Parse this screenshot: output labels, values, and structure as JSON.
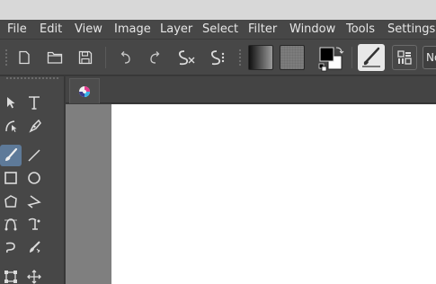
{
  "menubar": {
    "items": [
      "File",
      "Edit",
      "View",
      "Image",
      "Layer",
      "Select",
      "Filter",
      "Window",
      "Tools",
      "Settings"
    ]
  },
  "toolbar": {
    "buttons": [
      "new-document",
      "open-document",
      "save",
      "undo",
      "redo",
      "clear-selection",
      "select-all",
      "gradient",
      "pattern",
      "foreground-background-colors",
      "brush-preset",
      "workspace-chooser"
    ],
    "combo_label": "No"
  },
  "toolbox": {
    "tools": [
      "select-shapes",
      "text",
      "edit-shapes",
      "calligraphy",
      "freehand-brush",
      "line",
      "rectangle",
      "ellipse",
      "polygon",
      "polyline",
      "bezier-curve",
      "dynamic-brush",
      "freehand-path",
      "multibrush",
      "transform",
      "move"
    ],
    "active_tool": "freehand-brush"
  },
  "colors": {
    "window_bg": "#474747",
    "canvas_surround": "#7f7f7f",
    "canvas": "#ffffff",
    "active_tool": "#5e7a99",
    "text": "#e6e6e6"
  }
}
